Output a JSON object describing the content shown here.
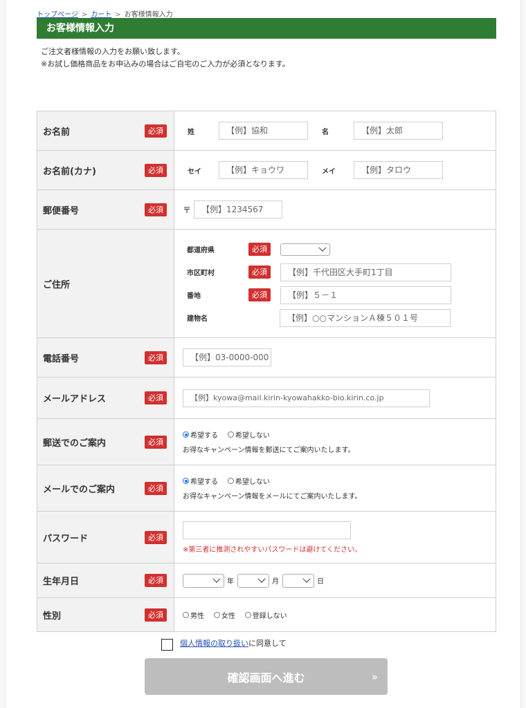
{
  "breadcrumb": {
    "home": "トップページ",
    "cart": "カート",
    "current": "お客様情報入力",
    "sep": ">"
  },
  "page_title": "お客様情報入力",
  "intro": {
    "line1": "ご注文者様情報の入力をお願い致します。",
    "line2": "※お試し価格商品をお申込みの場合はご自宅のご入力が必須となります。"
  },
  "required_badge": "必須",
  "name": {
    "label": "お名前",
    "sei_label": "姓",
    "sei_placeholder": "【例】協和",
    "mei_label": "名",
    "mei_placeholder": "【例】太郎"
  },
  "kana": {
    "label": "お名前(カナ)",
    "sei_label": "セイ",
    "sei_placeholder": "【例】キョウワ",
    "mei_label": "メイ",
    "mei_placeholder": "【例】タロウ"
  },
  "postal": {
    "label": "郵便番号",
    "mark": "〒",
    "placeholder": "【例】1234567"
  },
  "address": {
    "label": "ご住所",
    "prefecture_label": "都道府県",
    "city_label": "市区町村",
    "city_placeholder": "【例】千代田区大手町1丁目",
    "block_label": "番地",
    "block_placeholder": "【例】５－１",
    "building_label": "建物名",
    "building_placeholder": "【例】○○マンションＡ棟５０１号"
  },
  "phone": {
    "label": "電話番号",
    "placeholder": "【例】03-0000-000"
  },
  "email": {
    "label": "メールアドレス",
    "placeholder": "【例】kyowa@mail.kirin-kyowahakko-bio.kirin.co.jp"
  },
  "post_guide": {
    "label": "郵送でのご案内",
    "opt_yes": "希望する",
    "opt_no": "希望しない",
    "note": "お得なキャンペーン情報を郵送にてご案内いたします。"
  },
  "mail_guide": {
    "label": "メールでのご案内",
    "opt_yes": "希望する",
    "opt_no": "希望しない",
    "note": "お得なキャンペーン情報をメールにてご案内いたします。"
  },
  "password": {
    "label": "パスワード",
    "warning": "※第三者に推測されやすいパスワードは避けてください。"
  },
  "birthday": {
    "label": "生年月日",
    "year": "年",
    "month": "月",
    "day": "日"
  },
  "gender": {
    "label": "性別",
    "male": "男性",
    "female": "女性",
    "none": "登録しない"
  },
  "agree": {
    "link": "個人情報の取り扱い",
    "text": "に同意して"
  },
  "submit": {
    "label": "確認画面へ進む",
    "arrow": "»"
  }
}
